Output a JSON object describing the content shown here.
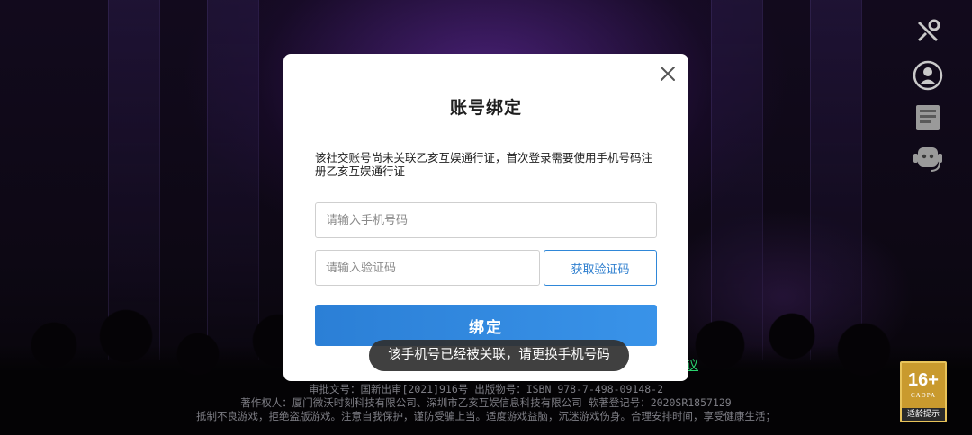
{
  "modal": {
    "title": "账号绑定",
    "description": "该社交账号尚未关联乙亥互娱通行证，首次登录需要使用手机号码注册乙亥互娱通行证",
    "phone_placeholder": "请输入手机号码",
    "phone_value": "",
    "code_placeholder": "请输入验证码",
    "code_value": "",
    "get_code_label": "获取验证码",
    "bind_label": "绑定",
    "close_icon": "close-icon"
  },
  "toast": {
    "message": "该手机号已经被关联，请更换手机号码"
  },
  "side_toolbar": {
    "items": [
      {
        "name": "tools-icon"
      },
      {
        "name": "user-account-icon"
      },
      {
        "name": "notice-icon"
      },
      {
        "name": "customer-service-icon"
      }
    ]
  },
  "footer": {
    "agreement_link": "议",
    "approval_line": "审批文号：国新出审[2021]916号 出版物号：ISBN 978-7-498-09148-2",
    "copyright_line": "著作权人：厦门微沃时刻科技有限公司、深圳市乙亥互娱信息科技有限公司 软著登记号：2020SR1857129",
    "health_line": "抵制不良游戏，拒绝盗版游戏。注意自我保护，谨防受骗上当。适度游戏益脑，沉迷游戏伤身。合理安排时间，享受健康生活；",
    "age_rating": "16+",
    "age_org": "CADPA",
    "age_label": "适龄提示"
  },
  "colors": {
    "primary": "#2f87d8",
    "link_green": "#2bd46f",
    "age_badge": "#c99a2e"
  }
}
